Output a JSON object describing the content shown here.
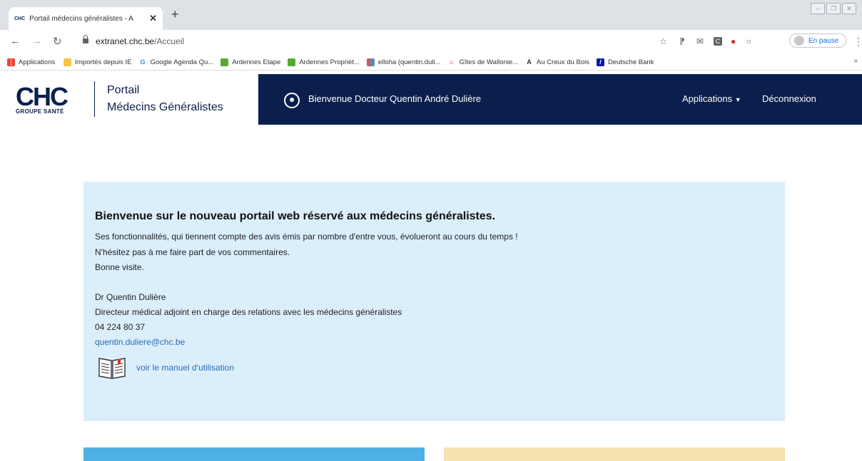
{
  "browser": {
    "tab": {
      "favicon": "CHC",
      "title": "Portail médecins généralistes - A"
    },
    "url": {
      "host": "extranet.chc.be",
      "path": "/Accueil"
    },
    "profile_label": "En pause",
    "bookmarks": [
      {
        "label": "Applications",
        "icon": "apps-grid-icon",
        "color": "#4285f4"
      },
      {
        "label": "Importés depuis IE",
        "icon": "folder-icon",
        "color": "#f4c542"
      },
      {
        "label": "Google Agenda Qu...",
        "icon": "google-icon",
        "color": "#4285f4"
      },
      {
        "label": "Ardennes Etape",
        "icon": "ardennes-icon",
        "color": "#5aa832"
      },
      {
        "label": "Ardennes Propriét...",
        "icon": "ardennes-icon",
        "color": "#5aa832"
      },
      {
        "label": "elloha (quentin.duli...",
        "icon": "elloha-icon",
        "color": "#e84d3d"
      },
      {
        "label": "Gîtes de Wallonie...",
        "icon": "gites-icon",
        "color": "#c0392b"
      },
      {
        "label": "Au Creux du Bois",
        "icon": "creux-icon",
        "color": "#333333"
      },
      {
        "label": "Deutsche Bank",
        "icon": "deutsche-bank-icon",
        "color": "#0018a8"
      }
    ]
  },
  "site": {
    "logo_text": "CHC",
    "logo_sub": "GROUPE SANTÉ",
    "portal_line1": "Portail",
    "portal_line2": "Médecins Généralistes",
    "welcome": "Bienvenue Docteur Quentin André Dulière",
    "nav_applications": "Applications",
    "nav_logout": "Déconnexion",
    "colors": {
      "navy": "#0b1f4d",
      "info_bg": "#dbeefb",
      "link": "#2a6fb0",
      "card_blue": "#4fb0e3",
      "card_yellow": "#f5e3ad"
    }
  },
  "content": {
    "title": "Bienvenue sur le nouveau portail web réservé aux médecins généralistes.",
    "line1": "Ses fonctionnalités, qui tiennent compte des avis émis par nombre d'entre vous, évolueront au cours du temps !",
    "line2": "N'hésitez pas à me faire part de vos commentaires.",
    "line3": "Bonne visite.",
    "sig_name": "Dr Quentin Dulière",
    "sig_role": "Directeur médical adjoint en charge des relations avec les médecins généralistes",
    "sig_phone": "04 224 80 37",
    "sig_email": "quentin.duliere@chc.be",
    "manual_link": "voir le manuel d'utilisation"
  }
}
